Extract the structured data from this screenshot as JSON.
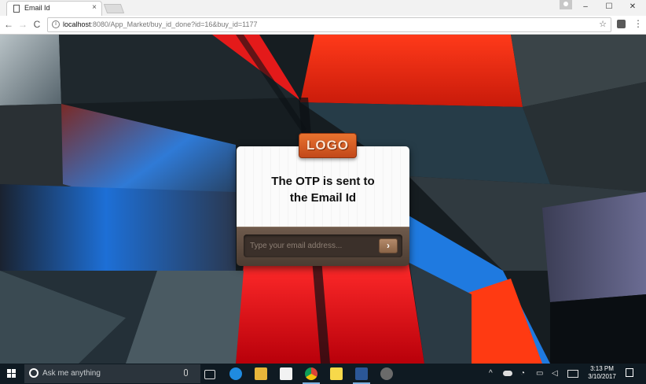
{
  "browser": {
    "tab_title": "Email Id",
    "tab_close": "×",
    "back_icon": "←",
    "forward_icon": "→",
    "reload_icon": "C",
    "url_host": "localhost",
    "url_path": ":8080/App_Market/buy_id_done?id=16&buy_id=1177",
    "minimize": "–",
    "maximize": "☐",
    "close": "✕",
    "star_icon": "☆",
    "menu_icon": "⋮"
  },
  "card": {
    "logo": "LOGO",
    "message_line1": "The OTP is sent to",
    "message_line2": "the Email Id",
    "email_placeholder": "Type your email address...",
    "submit_icon": "›"
  },
  "taskbar": {
    "search_placeholder": "Ask me anything",
    "time": "3:13 PM",
    "date": "3/10/2017",
    "tray_chevron": "^",
    "colors": {
      "background": "#0f1a22",
      "accent": "#7fb2e0"
    }
  },
  "theme": {
    "logo_orange": "#d75a22",
    "card_bottom": "#5a4a3e"
  }
}
